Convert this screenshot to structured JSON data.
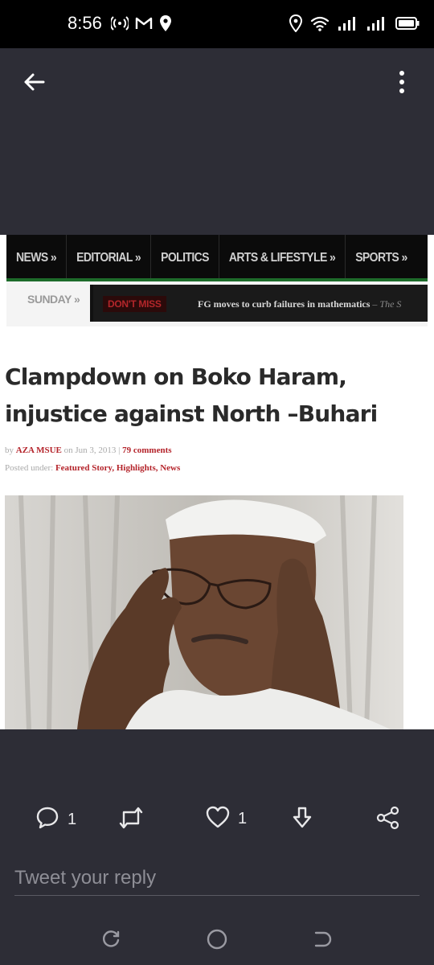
{
  "status_bar": {
    "time": "8:56",
    "left_icons": [
      "hotspot-icon",
      "gmail-icon",
      "location-icon"
    ],
    "right_icons": [
      "location-icon",
      "wifi-icon",
      "signal-icon",
      "signal-icon",
      "battery-icon"
    ]
  },
  "topbar": {
    "back_icon": "arrow-left-icon",
    "more_icon": "more-vertical-icon"
  },
  "media": {
    "nav": [
      "NEWS »",
      "EDITORIAL »",
      "POLITICS",
      "ARTS & LIFESTYLE »",
      "SPORTS »"
    ],
    "sunday": "SUNDAY »",
    "dont_miss": "DON'T MISS",
    "ticker_text": "FG moves to curb failures in mathematics",
    "ticker_source": "– The S",
    "headline_line1": "Clampdown on Boko Haram,",
    "headline_line2": "injustice against North –Buhari",
    "byline_prefix": "by",
    "author": "AZA MSUE",
    "date_text": "on Jun 3, 2013 |",
    "comments": "79 comments",
    "posted_prefix": "Posted under:",
    "categories": "Featured Story, Highlights, News"
  },
  "actions": {
    "reply_count": "1",
    "retweet_count": "",
    "like_count": "1"
  },
  "reply": {
    "placeholder": "Tweet your reply"
  },
  "colors": {
    "background": "#2d2d36",
    "accent_red": "#b4232a",
    "nav_green": "#1d6b2a"
  }
}
